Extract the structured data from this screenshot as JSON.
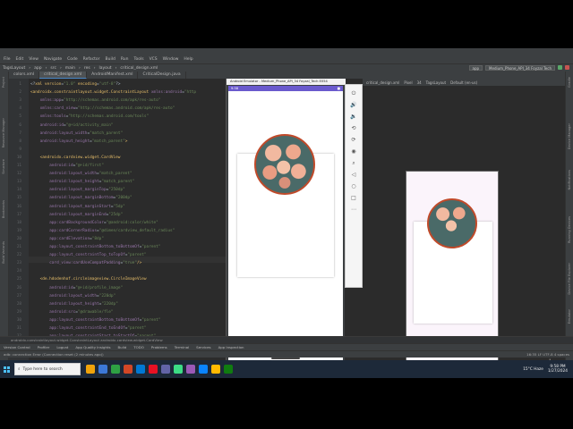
{
  "window": {
    "title": "TagsLayout - critical_design.xml [TagsLayout.app.main]"
  },
  "menu": [
    "File",
    "Edit",
    "View",
    "Navigate",
    "Code",
    "Refactor",
    "Build",
    "Run",
    "Tools",
    "VCS",
    "Window",
    "Help"
  ],
  "nav": [
    "TagsLayout",
    "app",
    "src",
    "main",
    "res",
    "layout",
    "critical_design.xml"
  ],
  "run": {
    "config": "app",
    "device": "Medium_Phone_API_34 Foyzal Tech"
  },
  "tabs": [
    {
      "label": "colors.xml",
      "active": false
    },
    {
      "label": "critical_design.xml",
      "active": true
    },
    {
      "label": "AndroidManifest.xml",
      "active": false
    },
    {
      "label": "CriticalDesign.java",
      "active": false
    }
  ],
  "left_panels": [
    "Project",
    "Resource Manager",
    "Structure",
    "Bookmarks",
    "Build Variants"
  ],
  "right_panels": [
    "Gradle",
    "Device Manager",
    "Notifications",
    "Running Devices",
    "Device File Explorer",
    "Emulator"
  ],
  "code_lines": [
    {
      "n": 1,
      "parts": [
        [
          "plain",
          "<?"
        ],
        [
          "tag",
          "xml version"
        ],
        [
          "plain",
          "="
        ],
        [
          "val",
          "\"1.0\""
        ],
        [
          "tag",
          " encoding"
        ],
        [
          "plain",
          "="
        ],
        [
          "val",
          "\"utf-8\""
        ],
        [
          "plain",
          "?>"
        ]
      ]
    },
    {
      "n": 2,
      "parts": [
        [
          "tag",
          "<androidx.constraintlayout.widget.ConstraintLayout "
        ],
        [
          "attr",
          "xmlns:android"
        ],
        [
          "plain",
          "="
        ],
        [
          "val",
          "\"http"
        ]
      ]
    },
    {
      "n": 3,
      "parts": [
        [
          "attr",
          "    xmlns:app"
        ],
        [
          "plain",
          "="
        ],
        [
          "val",
          "\"http://schemas.android.com/apk/res-auto\""
        ]
      ]
    },
    {
      "n": 4,
      "parts": [
        [
          "attr",
          "    xmlns:card_view"
        ],
        [
          "plain",
          "="
        ],
        [
          "val",
          "\"http://schemas.android.com/apk/res-auto\""
        ]
      ]
    },
    {
      "n": 5,
      "parts": [
        [
          "attr",
          "    xmlns:tools"
        ],
        [
          "plain",
          "="
        ],
        [
          "val",
          "\"http://schemas.android.com/tools\""
        ]
      ]
    },
    {
      "n": 6,
      "parts": [
        [
          "attr",
          "    android:id"
        ],
        [
          "plain",
          "="
        ],
        [
          "val",
          "\"@+id/activity_main\""
        ]
      ]
    },
    {
      "n": 7,
      "parts": [
        [
          "attr",
          "    android:layout_width"
        ],
        [
          "plain",
          "="
        ],
        [
          "val",
          "\"match_parent\""
        ]
      ]
    },
    {
      "n": 8,
      "parts": [
        [
          "attr",
          "    android:layout_height"
        ],
        [
          "plain",
          "="
        ],
        [
          "val",
          "\"match_parent\""
        ],
        [
          "tag",
          ">"
        ]
      ]
    },
    {
      "n": 9,
      "parts": []
    },
    {
      "n": 10,
      "parts": [
        [
          "tag",
          "    <androidx.cardview.widget.CardView"
        ]
      ]
    },
    {
      "n": 11,
      "parts": [
        [
          "attr",
          "        android:id"
        ],
        [
          "plain",
          "="
        ],
        [
          "val",
          "\"@+id/first\""
        ]
      ]
    },
    {
      "n": 12,
      "parts": [
        [
          "attr",
          "        android:layout_width"
        ],
        [
          "plain",
          "="
        ],
        [
          "val",
          "\"match_parent\""
        ]
      ]
    },
    {
      "n": 13,
      "parts": [
        [
          "attr",
          "        android:layout_height"
        ],
        [
          "plain",
          "="
        ],
        [
          "val",
          "\"match_parent\""
        ]
      ]
    },
    {
      "n": 14,
      "parts": [
        [
          "attr",
          "        android:layout_marginTop"
        ],
        [
          "plain",
          "="
        ],
        [
          "val",
          "\"250dp\""
        ]
      ]
    },
    {
      "n": 15,
      "parts": [
        [
          "attr",
          "        android:layout_marginBottom"
        ],
        [
          "plain",
          "="
        ],
        [
          "val",
          "\"200dp\""
        ]
      ]
    },
    {
      "n": 16,
      "parts": [
        [
          "attr",
          "        android:layout_marginStart"
        ],
        [
          "plain",
          "="
        ],
        [
          "val",
          "\"5dp\""
        ]
      ]
    },
    {
      "n": 17,
      "parts": [
        [
          "attr",
          "        android:layout_marginEnd"
        ],
        [
          "plain",
          "="
        ],
        [
          "val",
          "\"25dp\""
        ]
      ]
    },
    {
      "n": 18,
      "parts": [
        [
          "attr",
          "        app:cardBackgroundColor"
        ],
        [
          "plain",
          "="
        ],
        [
          "val",
          "\"@android:color/white\""
        ]
      ]
    },
    {
      "n": 19,
      "parts": [
        [
          "attr",
          "        app:cardCornerRadius"
        ],
        [
          "plain",
          "="
        ],
        [
          "val",
          "\"@dimen/cardview_default_radius\""
        ]
      ]
    },
    {
      "n": 20,
      "parts": [
        [
          "attr",
          "        app:cardElevation"
        ],
        [
          "plain",
          "="
        ],
        [
          "val",
          "\"8dp\""
        ]
      ]
    },
    {
      "n": 21,
      "parts": [
        [
          "attr",
          "        app:layout_constraintBottom_toBottomOf"
        ],
        [
          "plain",
          "="
        ],
        [
          "val",
          "\"parent\""
        ]
      ]
    },
    {
      "n": 22,
      "parts": [
        [
          "attr",
          "        app:layout_constraintTop_toTopOf"
        ],
        [
          "plain",
          "="
        ],
        [
          "val",
          "\"parent\""
        ]
      ]
    },
    {
      "n": 23,
      "parts": [
        [
          "attr",
          "        card_view:cardUseCompatPadding"
        ],
        [
          "plain",
          "="
        ],
        [
          "val",
          "\"true\""
        ],
        [
          "tag",
          "/>"
        ]
      ]
    },
    {
      "n": 24,
      "parts": []
    },
    {
      "n": 25,
      "parts": [
        [
          "tag",
          "    <de.hdodenhof.circleimageview.CircleImageView"
        ]
      ]
    },
    {
      "n": 26,
      "parts": [
        [
          "attr",
          "        android:id"
        ],
        [
          "plain",
          "="
        ],
        [
          "val",
          "\"@+id/profile_image\""
        ]
      ]
    },
    {
      "n": 27,
      "parts": [
        [
          "attr",
          "        android:layout_width"
        ],
        [
          "plain",
          "="
        ],
        [
          "val",
          "\"220dp\""
        ]
      ]
    },
    {
      "n": 28,
      "parts": [
        [
          "attr",
          "        android:layout_height"
        ],
        [
          "plain",
          "="
        ],
        [
          "val",
          "\"220dp\""
        ]
      ]
    },
    {
      "n": 29,
      "parts": [
        [
          "attr",
          "        android:src"
        ],
        [
          "plain",
          "="
        ],
        [
          "val",
          "\"@drawable/fle\""
        ]
      ]
    },
    {
      "n": 30,
      "parts": [
        [
          "attr",
          "        app:layout_constraintBottom_toBottomOf"
        ],
        [
          "plain",
          "="
        ],
        [
          "val",
          "\"parent\""
        ]
      ]
    },
    {
      "n": 31,
      "parts": [
        [
          "attr",
          "        app:layout_constraintEnd_toEndOf"
        ],
        [
          "plain",
          "="
        ],
        [
          "val",
          "\"parent\""
        ]
      ]
    },
    {
      "n": 32,
      "parts": [
        [
          "attr",
          "        app:layout_constraintStart_toStartOf"
        ],
        [
          "plain",
          "="
        ],
        [
          "val",
          "\"parent\""
        ]
      ]
    }
  ],
  "emulator": {
    "title": "Android Emulator - Medium_Phone_API_34 Foyzal_Tech:5554",
    "time": "9:58",
    "battery": "■"
  },
  "design": {
    "toolbar": [
      "critical_design.xml",
      "Pixel",
      "34",
      "TagsLayout",
      "Default (en-us)"
    ]
  },
  "crumbs": "androidx.constraintlayout.widget.ConstraintLayout   androidx.cardview.widget.CardView",
  "bottom_windows": [
    "Version Control",
    "Profiler",
    "Logcat",
    "App Quality Insights",
    "Build",
    "TODO",
    "Problems",
    "Terminal",
    "Services",
    "App Inspection"
  ],
  "status": {
    "left": "adb: connection Error (Connection reset (2 minutes ago))",
    "right": "16:35   LF   UTF-8   4 spaces"
  },
  "taskbar": {
    "search_placeholder": "Type here to search",
    "weather": "15°C  Haze",
    "time": "9:58 PM",
    "date": "1/27/2024",
    "apps": [
      "#f0a30a",
      "#3c78d8",
      "#2ea043",
      "#d24726",
      "#0078d4",
      "#e81123",
      "#6264a7",
      "#3ddc84",
      "#9b59b6",
      "#0a84ff",
      "#ffb900",
      "#107c10"
    ]
  }
}
